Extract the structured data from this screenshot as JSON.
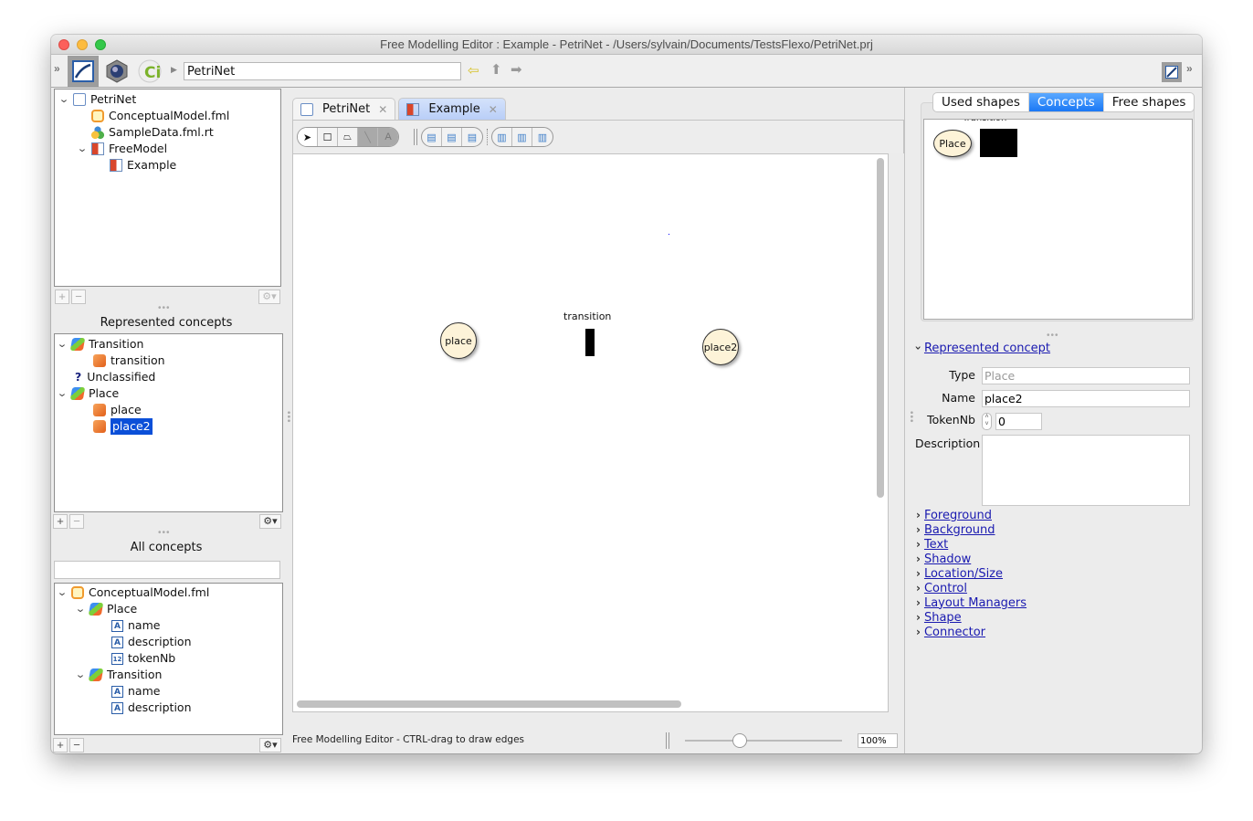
{
  "window": {
    "title": "Free Modelling Editor : Example - PetriNet - /Users/sylvain/Documents/TestsFlexo/PetriNet.prj"
  },
  "toolbar": {
    "path_value": "PetriNet",
    "icons": [
      "perspective-toggle-icon",
      "fml-perspective-icon",
      "technology-icon",
      "free-model-icon",
      "breadcrumb-arrow-icon",
      "back-arrow-icon",
      "up-arrow-icon",
      "forward-arrow-icon",
      "view-toggle-icon",
      "collapse-chevrons-icon"
    ]
  },
  "project_tree": {
    "items": [
      {
        "label": "PetriNet",
        "icon": "project-icon",
        "expanded": true
      },
      {
        "label": "ConceptualModel.fml",
        "icon": "fml-icon"
      },
      {
        "label": "SampleData.fml.rt",
        "icon": "sample-data-icon"
      },
      {
        "label": "FreeModel",
        "icon": "free-model-icon",
        "expanded": true
      },
      {
        "label": "Example",
        "icon": "diagram-icon"
      }
    ]
  },
  "represented_concepts": {
    "title": "Represented concepts",
    "items": [
      {
        "label": "Transition",
        "icon": "concept-icon",
        "expanded": true
      },
      {
        "label": "transition",
        "icon": "instance-icon"
      },
      {
        "label": "Unclassified",
        "icon": "question-icon"
      },
      {
        "label": "Place",
        "icon": "concept-icon",
        "expanded": true
      },
      {
        "label": "place",
        "icon": "instance-icon"
      },
      {
        "label": "place2",
        "icon": "instance-icon",
        "selected": true
      }
    ]
  },
  "all_concepts": {
    "title": "All concepts",
    "search_value": "",
    "items": [
      {
        "label": "ConceptualModel.fml",
        "icon": "fml-icon",
        "expanded": true
      },
      {
        "label": "Place",
        "icon": "concept-icon",
        "expanded": true
      },
      {
        "label": "name",
        "icon": "text-attribute-icon",
        "glyph": "A"
      },
      {
        "label": "description",
        "icon": "text-attribute-icon",
        "glyph": "A"
      },
      {
        "label": "tokenNb",
        "icon": "integer-attribute-icon",
        "glyph": "12"
      },
      {
        "label": "Transition",
        "icon": "concept-icon",
        "expanded": true
      },
      {
        "label": "name",
        "icon": "text-attribute-icon",
        "glyph": "A"
      },
      {
        "label": "description",
        "icon": "text-attribute-icon",
        "glyph": "A"
      }
    ]
  },
  "editor": {
    "tabs": [
      {
        "label": "PetriNet",
        "active": false
      },
      {
        "label": "Example",
        "active": true
      }
    ],
    "tools": [
      "select-tool",
      "rectangle-tool",
      "shape-tool",
      "connector-tool",
      "text-tool"
    ],
    "align_tools": [
      "align-left",
      "align-center",
      "align-right",
      "align-top",
      "align-middle",
      "align-bottom"
    ],
    "diagram": {
      "places": [
        {
          "label": "place"
        },
        {
          "label": "place2"
        }
      ],
      "transitions": [
        {
          "label": "transition"
        }
      ]
    },
    "status": "Free Modelling Editor - CTRL-drag to draw edges",
    "zoom": "100%",
    "zoom_fraction": 0.35
  },
  "palette": {
    "tabs": [
      {
        "label": "Used shapes",
        "active": false
      },
      {
        "label": "Concepts",
        "active": true
      },
      {
        "label": "Free shapes",
        "active": false
      }
    ],
    "items": [
      {
        "label": "Place",
        "shape": "ellipse"
      },
      {
        "label": "Transition",
        "shape": "black-rect"
      }
    ]
  },
  "inspector": {
    "section": "Represented concept",
    "fields": {
      "type_label": "Type",
      "type_value": "Place",
      "name_label": "Name",
      "name_value": "place2",
      "tokennb_label": "TokenNb",
      "tokennb_value": "0",
      "description_label": "Description",
      "description_value": ""
    },
    "links": [
      "Foreground",
      "Background",
      "Text",
      "Shadow",
      "Location/Size",
      "Control",
      "Layout Managers",
      "Shape",
      "Connector"
    ]
  },
  "colors": {
    "selection": "#0b4fd8",
    "active_tab": "#1a78f5",
    "link": "#1a1ab0",
    "place_fill": "#fdf3d8"
  }
}
